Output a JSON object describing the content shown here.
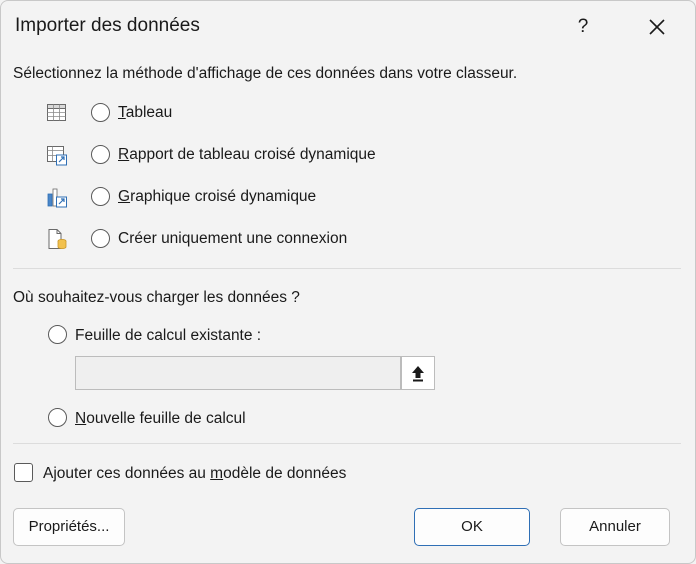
{
  "dialog": {
    "title": "Importer des données",
    "help": "?"
  },
  "display": {
    "prompt": "Sélectionnez la méthode d'affichage de ces données dans votre classeur.",
    "options": [
      {
        "icon": "table-icon",
        "accel": "T",
        "rest": "ableau",
        "selected": false
      },
      {
        "icon": "pivot-table-icon",
        "accel": "R",
        "rest": "apport de tableau croisé dynamique",
        "selected": false
      },
      {
        "icon": "pivot-chart-icon",
        "accel": "G",
        "rest": "raphique croisé dynamique",
        "selected": false
      },
      {
        "icon": "connection-icon",
        "label": "Créer uniquement une connexion",
        "selected": false
      }
    ]
  },
  "location": {
    "prompt": "Où souhaitez-vous charger les données ?",
    "existing_label": "Feuille de calcul existante :",
    "range_value": "",
    "new_accel": "N",
    "new_rest": "ouvelle feuille de calcul"
  },
  "model": {
    "pre": "Ajouter ces données au ",
    "accel": "m",
    "post": "odèle de données",
    "checked": false
  },
  "buttons": {
    "properties": "Propriétés...",
    "ok": "OK",
    "cancel": "Annuler"
  },
  "colors": {
    "accent": "#2f6fb5",
    "background": "#f3f3f3"
  }
}
